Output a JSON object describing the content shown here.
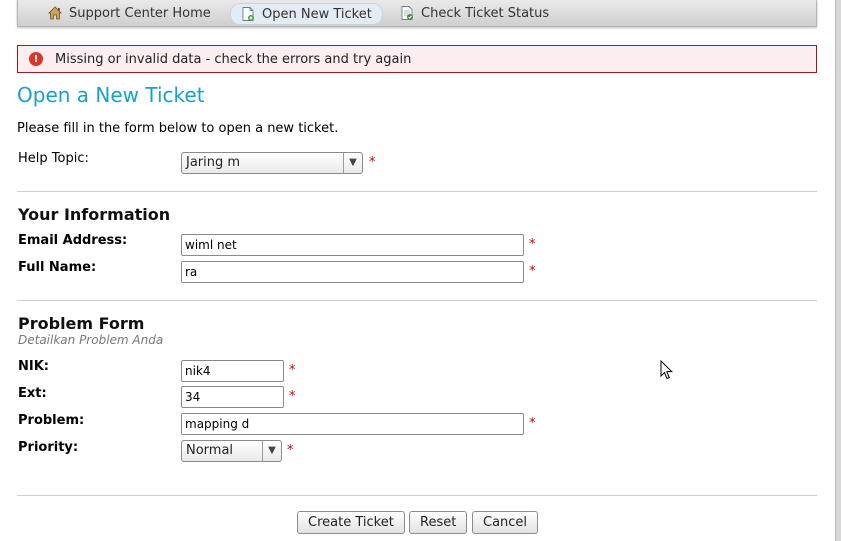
{
  "nav": {
    "items": [
      {
        "label": "Support Center Home",
        "icon": "home-icon"
      },
      {
        "label": "Open New Ticket",
        "icon": "new-ticket-icon",
        "active": true
      },
      {
        "label": "Check Ticket Status",
        "icon": "ticket-status-icon"
      }
    ]
  },
  "error": {
    "message": "Missing or invalid data - check the errors and try again",
    "color": "#a41818"
  },
  "page": {
    "title": "Open a New Ticket",
    "intro": "Please fill in the form below to open a new ticket."
  },
  "help_topic": {
    "label": "Help Topic:",
    "value": "Jaring             m"
  },
  "your_info": {
    "title": "Your Information",
    "email_label": "Email Address:",
    "email_value": "wiml                          net",
    "name_label": "Full Name:",
    "name_value": "ra"
  },
  "problem_form": {
    "title": "Problem Form",
    "subtitle": "Detailkan Problem Anda",
    "nik_label": "NIK:",
    "nik_value": "nik4",
    "ext_label": "Ext:",
    "ext_value": "34",
    "problem_label": "Problem:",
    "problem_value": "mapping d",
    "priority_label": "Priority:",
    "priority_value": "Normal"
  },
  "required_mark": "*",
  "buttons": {
    "create": "Create Ticket",
    "reset": "Reset",
    "cancel": "Cancel"
  },
  "colors": {
    "title": "#1aa0c8",
    "required": "#d40000"
  }
}
